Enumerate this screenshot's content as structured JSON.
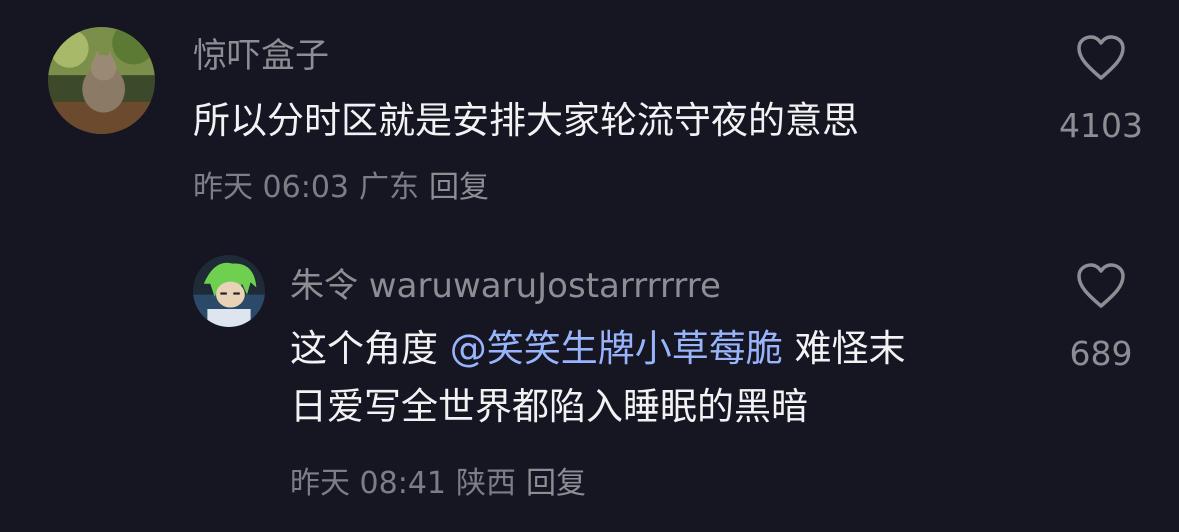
{
  "comments": [
    {
      "username": "惊吓盒子",
      "text_lines": [
        "所以分时区就是安排大家轮流守夜的意思"
      ],
      "time": "昨天 06:03",
      "location": "广东",
      "reply_label": "回复",
      "likes": "4103",
      "avatar_icon": "cat-photo-avatar"
    },
    {
      "username": "朱令 waruwaruJostarrrrrre",
      "text_before_mention": "这个角度 ",
      "mention": "@笑笑生牌小草莓脆",
      "text_after_mention": " 难怪末",
      "text_line2": "日爱写全世界都陷入睡眠的黑暗",
      "time": "昨天 08:41",
      "location": "陕西",
      "reply_label": "回复",
      "likes": "689",
      "avatar_icon": "anime-character-avatar"
    }
  ],
  "colors": {
    "background": "#161622",
    "text": "#f2f2f4",
    "secondary": "#8d8d94",
    "mention": "#98b4ff"
  }
}
